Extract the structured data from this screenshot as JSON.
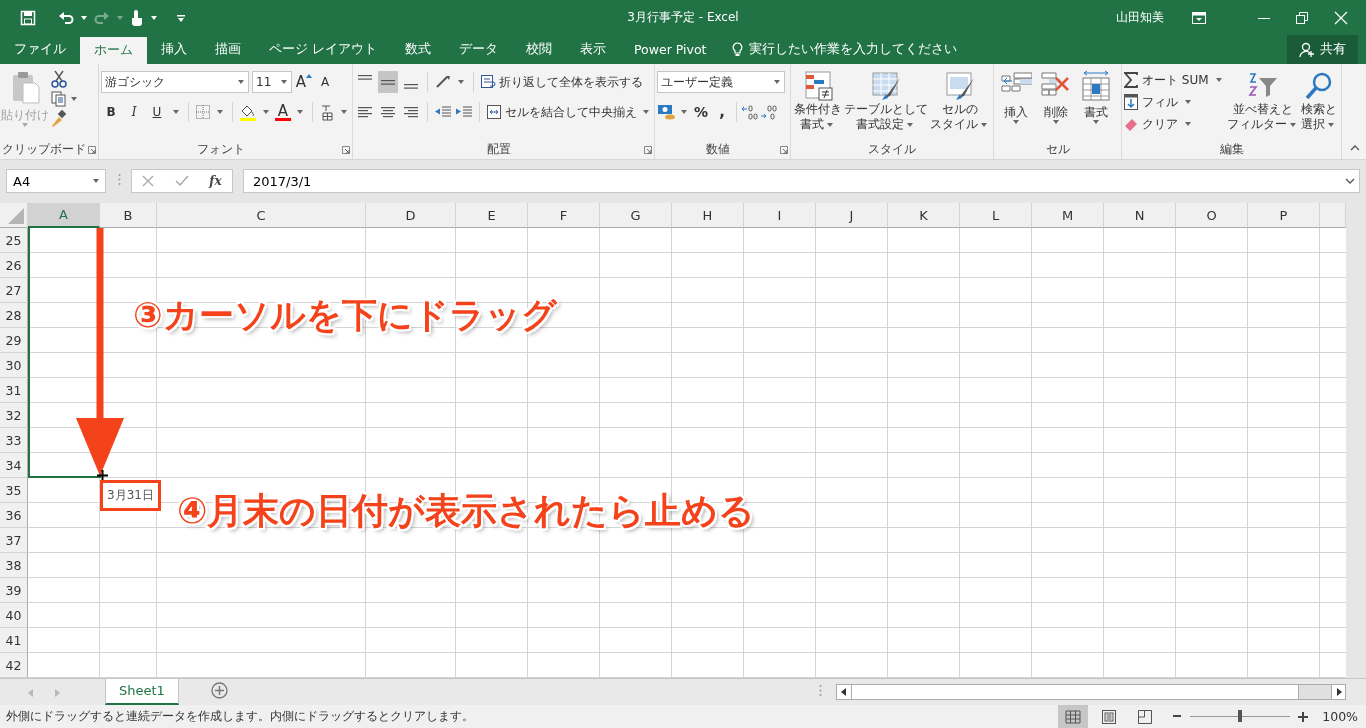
{
  "title_bar": {
    "title": "3月行事予定 - Excel",
    "user": "山田知美",
    "redo_disabled": true
  },
  "tabs": [
    {
      "label": "ファイル",
      "selected": false
    },
    {
      "label": "ホーム",
      "selected": true
    },
    {
      "label": "挿入",
      "selected": false
    },
    {
      "label": "描画",
      "selected": false
    },
    {
      "label": "ページ レイアウト",
      "selected": false
    },
    {
      "label": "数式",
      "selected": false
    },
    {
      "label": "データ",
      "selected": false
    },
    {
      "label": "校閲",
      "selected": false
    },
    {
      "label": "表示",
      "selected": false
    },
    {
      "label": "Power Pivot",
      "selected": false
    }
  ],
  "tell_me": {
    "placeholder": "実行したい作業を入力してください"
  },
  "share": {
    "label": "共有"
  },
  "ribbon": {
    "clipboard": {
      "paste": "貼り付け",
      "paste_disabled": true,
      "label": "クリップボード"
    },
    "font": {
      "font_name": "游ゴシック",
      "font_size": "11",
      "grow": "A",
      "shrink": "A",
      "bold": "B",
      "italic": "I",
      "underline": "U",
      "font_color": "A",
      "label": "フォント"
    },
    "alignment": {
      "vertical_align": [
        {
          "selected": false
        },
        {
          "selected": true
        },
        {
          "selected": false
        }
      ],
      "wrap_text": "折り返して全体を表示する",
      "merge": "セルを結合して中央揃え",
      "label": "配置"
    },
    "number": {
      "format": "ユーザー定義",
      "percent": "%",
      "comma": ",",
      "label": "数値"
    },
    "styles": {
      "buttons": [
        {
          "lines": [
            "条件付き",
            "書式"
          ]
        },
        {
          "lines": [
            "テーブルとして",
            "書式設定"
          ]
        },
        {
          "lines": [
            "セルの",
            "スタイル"
          ]
        }
      ],
      "label": "スタイル"
    },
    "cells": {
      "buttons": [
        "挿入",
        "削除",
        "書式"
      ],
      "label": "セル"
    },
    "editing": {
      "autosum": "オート SUM",
      "fill": "フィル",
      "clear": "クリア",
      "sort": [
        "並べ替えと",
        "フィルター"
      ],
      "find": [
        "検索と",
        "選択"
      ],
      "label": "編集"
    }
  },
  "formula_bar": {
    "name_box": "A4",
    "function_label": "fx",
    "formula": "2017/3/1"
  },
  "sheet": {
    "columns": [
      {
        "label": "A",
        "selected": true
      },
      {
        "label": "B",
        "selected": false
      },
      {
        "label": "C",
        "selected": false
      },
      {
        "label": "D",
        "selected": false
      },
      {
        "label": "E",
        "selected": false
      },
      {
        "label": "F",
        "selected": false
      },
      {
        "label": "G",
        "selected": false
      },
      {
        "label": "H",
        "selected": false
      },
      {
        "label": "I",
        "selected": false
      },
      {
        "label": "J",
        "selected": false
      },
      {
        "label": "K",
        "selected": false
      },
      {
        "label": "L",
        "selected": false
      },
      {
        "label": "M",
        "selected": false
      },
      {
        "label": "N",
        "selected": false
      },
      {
        "label": "O",
        "selected": false
      },
      {
        "label": "P",
        "selected": false
      }
    ],
    "rows": [
      "25",
      "26",
      "27",
      "28",
      "29",
      "30",
      "31",
      "32",
      "33",
      "34",
      "35",
      "36",
      "37",
      "38",
      "39",
      "40",
      "41",
      "42"
    ],
    "annotations": {
      "drag_hint": "③カーソルを下にドラッグ",
      "stop_hint": "④月末の日付が表示されたら止める",
      "fill_tooltip": "3月31日"
    }
  },
  "sheet_tabs": [
    {
      "label": "Sheet1",
      "selected": true
    }
  ],
  "status_bar": {
    "message": "外側にドラッグすると連続データを作成します。内側にドラッグするとクリアします。",
    "views": [
      {
        "selected": true
      },
      {
        "selected": false
      },
      {
        "selected": false
      }
    ],
    "zoom": {
      "level": 0.5,
      "label": "100%"
    }
  }
}
